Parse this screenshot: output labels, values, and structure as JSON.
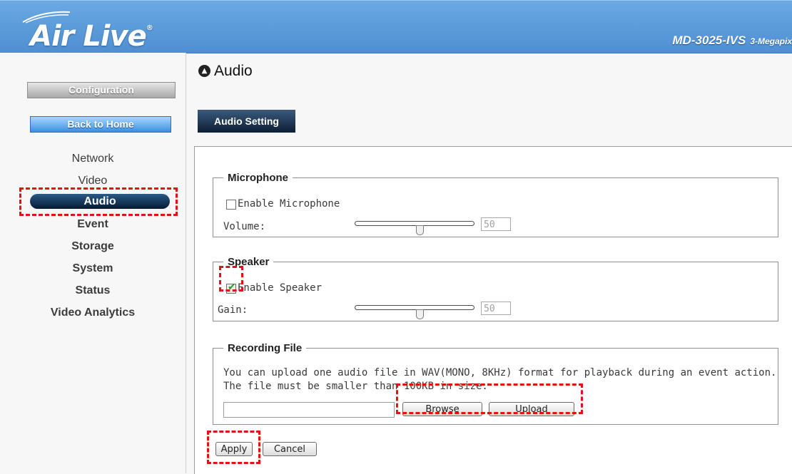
{
  "header": {
    "logo_text": "Air Live",
    "logo_reg": "®",
    "model": "MD-3025-IVS",
    "model_sub": "3-Megapix"
  },
  "sidebar": {
    "configuration_label": "Configuration",
    "back_home_label": "Back to Home",
    "items": [
      {
        "label": "Network"
      },
      {
        "label": "Video"
      },
      {
        "label": "Audio",
        "active": true
      },
      {
        "label": "Event"
      },
      {
        "label": "Storage"
      },
      {
        "label": "System"
      },
      {
        "label": "Status"
      },
      {
        "label": "Video Analytics"
      }
    ]
  },
  "page": {
    "title": "Audio",
    "tab": "Audio Setting"
  },
  "microphone": {
    "legend": "Microphone",
    "enable_label": "Enable Microphone",
    "enabled": false,
    "volume_label": "Volume:",
    "volume": "50"
  },
  "speaker": {
    "legend": "Speaker",
    "enable_label": "Enable Speaker",
    "enabled": true,
    "gain_label": "Gain:",
    "gain": "50"
  },
  "recording": {
    "legend": "Recording File",
    "line1": "You can upload one audio file in WAV(MONO, 8KHz) format for playback during an event action.",
    "line2": "The file must be smaller than 100KB in size.",
    "file_value": "",
    "browse_label": "Browse",
    "upload_label": "Upload"
  },
  "actions": {
    "apply_label": "Apply",
    "cancel_label": "Cancel"
  },
  "colors": {
    "header_blue": "#5a9bd9",
    "highlight_red": "#e01414",
    "active_nav": "#0b2a4d"
  }
}
